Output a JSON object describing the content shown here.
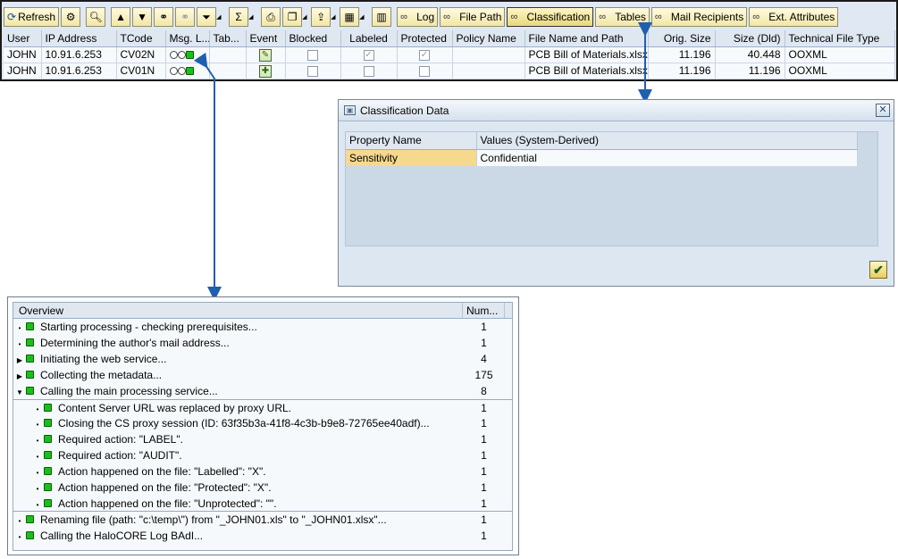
{
  "toolbar": {
    "refresh_label": "Refresh",
    "log_label": "Log",
    "file_path_label": "File Path",
    "classification_label": "Classification",
    "tables_label": "Tables",
    "mail_recipients_label": "Mail Recipients",
    "ext_attributes_label": "Ext. Attributes"
  },
  "grid": {
    "columns": [
      "User",
      "IP Address",
      "TCode",
      "Msg. L...",
      "Tab...",
      "Event",
      "Blocked",
      "Labeled",
      "Protected",
      "Policy Name",
      "File Name and Path",
      "Orig. Size",
      "Size (Dld)",
      "Technical File Type"
    ],
    "rows": [
      {
        "user": "JOHN",
        "ip": "10.91.6.253",
        "tcode": "CV02N",
        "blocked": false,
        "labeled": true,
        "protected": true,
        "policy": "",
        "file": "PCB Bill of Materials.xlsx",
        "orig_size": "11.196",
        "size_dld": "40.448",
        "type": "OOXML"
      },
      {
        "user": "JOHN",
        "ip": "10.91.6.253",
        "tcode": "CV01N",
        "blocked": false,
        "labeled": false,
        "protected": false,
        "policy": "",
        "file": "PCB Bill of Materials.xlsx",
        "orig_size": "11.196",
        "size_dld": "11.196",
        "type": "OOXML"
      }
    ]
  },
  "classification": {
    "title": "Classification Data",
    "columns": [
      "Property Name",
      "Values (System-Derived)"
    ],
    "rows": [
      {
        "name": "Sensitivity",
        "value": "Confidential"
      }
    ]
  },
  "overview": {
    "columns": [
      "Overview",
      "Num..."
    ],
    "rows": [
      {
        "expander": "bullet",
        "text": "Starting processing - checking prerequisites...",
        "count": "1"
      },
      {
        "expander": "bullet",
        "text": "Determining the author's mail address...",
        "count": "1"
      },
      {
        "expander": "collapsed",
        "text": "Initiating the web service...",
        "count": "4"
      },
      {
        "expander": "collapsed",
        "text": "Collecting the metadata...",
        "count": "175"
      },
      {
        "expander": "expanded",
        "text": "Calling the main processing service...",
        "count": "8"
      }
    ],
    "children": [
      {
        "text": "Content Server URL was replaced by proxy URL.",
        "count": "1"
      },
      {
        "text": "Closing the CS proxy session (ID: 63f35b3a-41f8-4c3b-b9e8-72765ee40adf)...",
        "count": "1"
      },
      {
        "text": "Required action: \"LABEL\".",
        "count": "1"
      },
      {
        "text": "Required action: \"AUDIT\".",
        "count": "1"
      },
      {
        "text": "Action happened on the file: \"Labelled\": \"X\".",
        "count": "1"
      },
      {
        "text": "Action happened on the file: \"Protected\": \"X\".",
        "count": "1"
      },
      {
        "text": "Action happened on the file: \"Unprotected\": \"\".",
        "count": "1"
      }
    ],
    "tail": [
      {
        "expander": "bullet",
        "text": "Renaming file (path: \"c:\\temp\\\") from \"_JOHN01.xls\" to \"_JOHN01.xlsx\"...",
        "count": "1"
      },
      {
        "expander": "bullet",
        "text": "Calling the HaloCORE Log BAdI...",
        "count": "1"
      }
    ]
  },
  "colors": {
    "status_green": "#18c018",
    "arrow_blue": "#1f5fae",
    "selection_yellow": "#f6d98d"
  }
}
